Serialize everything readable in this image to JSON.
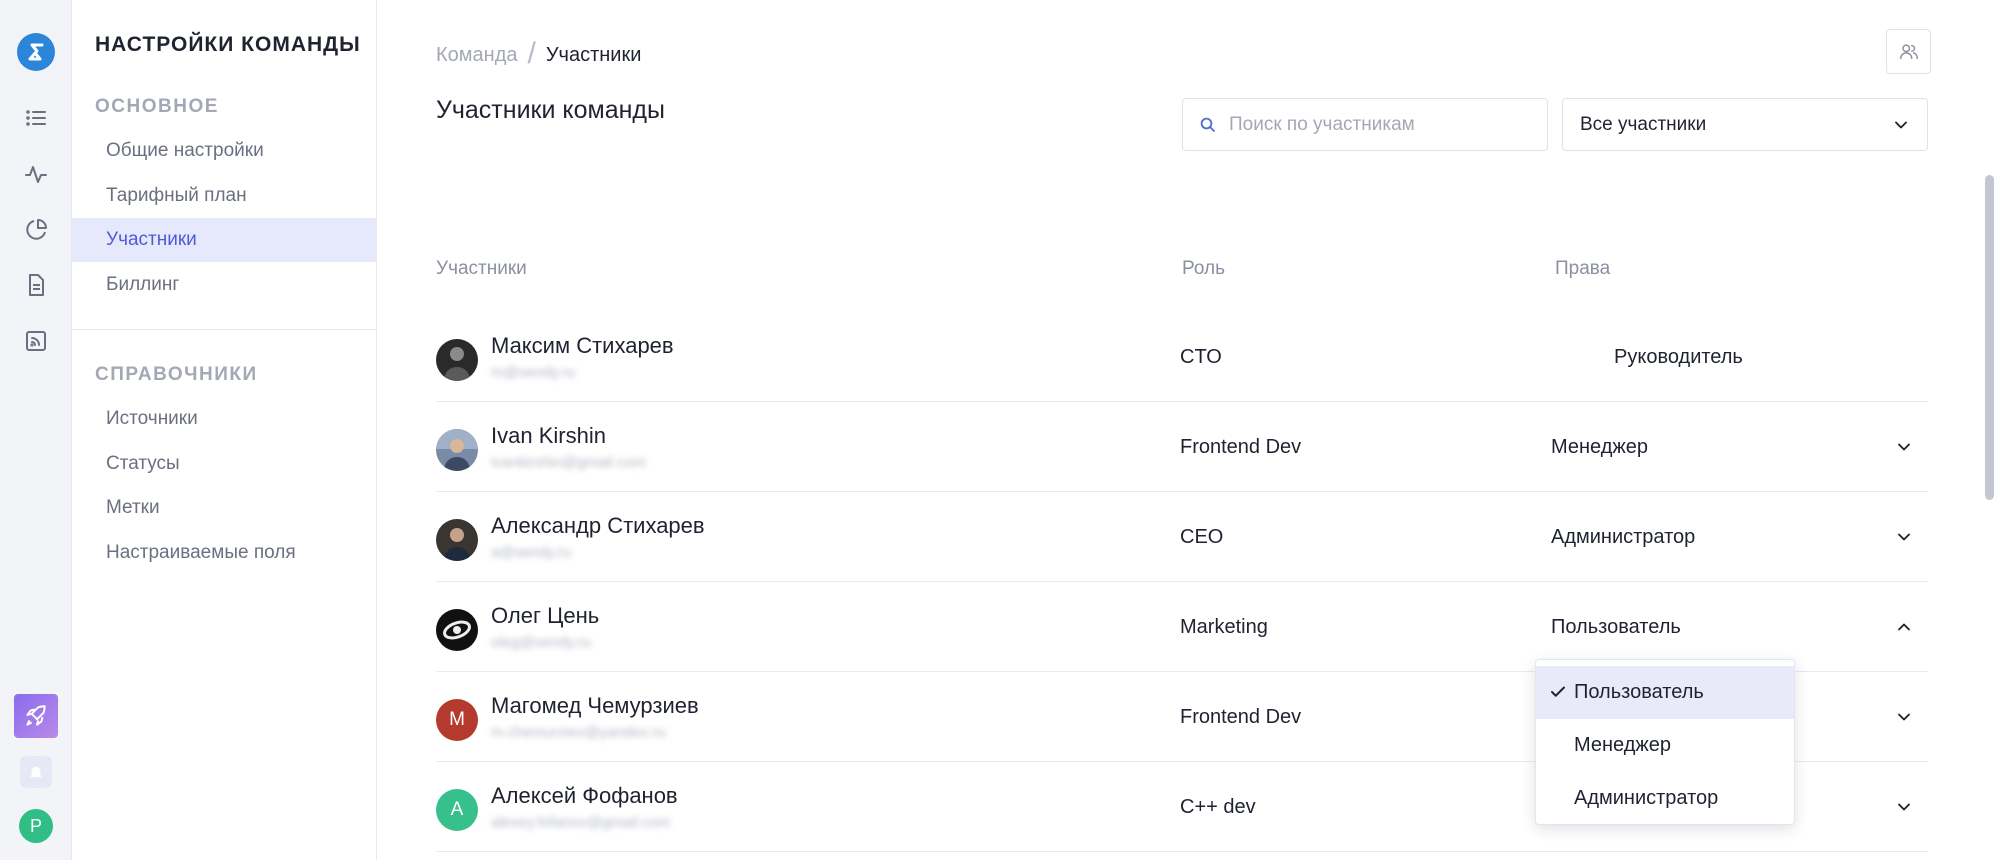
{
  "rail": {
    "logo_icon": "sendpulse-logo-icon",
    "items": [
      "list-icon",
      "pulse-icon",
      "pie-chart-icon",
      "document-icon",
      "rss-icon"
    ],
    "avatar_letter": "P",
    "colors": {
      "logo": "#2b86d9",
      "avatar": "#2fbf86"
    }
  },
  "sidebar": {
    "title": "НАСТРОЙКИ КОМАНДЫ",
    "section_main": "ОСНОВНОЕ",
    "main_items": [
      {
        "label": "Общие настройки"
      },
      {
        "label": "Тарифный план"
      },
      {
        "label": "Участники",
        "active": true
      },
      {
        "label": "Биллинг"
      }
    ],
    "section_refs": "СПРАВОЧНИКИ",
    "ref_items": [
      {
        "label": "Источники"
      },
      {
        "label": "Статусы"
      },
      {
        "label": "Метки"
      },
      {
        "label": "Настраиваемые поля"
      }
    ]
  },
  "header": {
    "breadcrumb_parent": "Команда",
    "breadcrumb_current": "Участники",
    "page_title": "Участники команды"
  },
  "toolbar": {
    "search_placeholder": "Поиск по участникам",
    "filter_value": "Все участники"
  },
  "table": {
    "columns": [
      "Участники",
      "Роль",
      "Права"
    ],
    "rows": [
      {
        "name": "Максим Стихарев",
        "email": "m@sendy.ru",
        "role": "CTO",
        "permission": "Руководитель",
        "avatar_letter": "",
        "avatar_color": "#2a2a2a",
        "has_chevron": false
      },
      {
        "name": "Ivan Kirshin",
        "email": "ivankirshin@gmail.com",
        "role": "Frontend Dev",
        "permission": "Менеджер",
        "avatar_letter": "",
        "avatar_color": "#6f7d94",
        "has_chevron": true,
        "expanded": false
      },
      {
        "name": "Александр Стихарев",
        "email": "a@sendy.ru",
        "role": "CEO",
        "permission": "Администратор",
        "avatar_letter": "",
        "avatar_color": "#3a3530",
        "has_chevron": true,
        "expanded": false
      },
      {
        "name": "Олег Цень",
        "email": "oleg@sendy.ru",
        "role": "Marketing",
        "permission": "Пользователь",
        "avatar_letter": "",
        "avatar_color": "#111111",
        "has_chevron": true,
        "expanded": true
      },
      {
        "name": "Магомед Чемурзиев",
        "email": "m.chemurziev@yandex.ru",
        "role": "Frontend Dev",
        "permission": "",
        "avatar_letter": "М",
        "avatar_color": "#b33a2c",
        "has_chevron": true,
        "expanded": false
      },
      {
        "name": "Алексей Фофанов",
        "email": "alexey.fofanov@gmail.com",
        "role": "C++ dev",
        "permission": "",
        "avatar_letter": "А",
        "avatar_color": "#37c08c",
        "has_chevron": true,
        "expanded": false
      }
    ]
  },
  "permission_dropdown": {
    "options": [
      "Пользователь",
      "Менеджер",
      "Администратор"
    ],
    "selected": "Пользователь"
  }
}
